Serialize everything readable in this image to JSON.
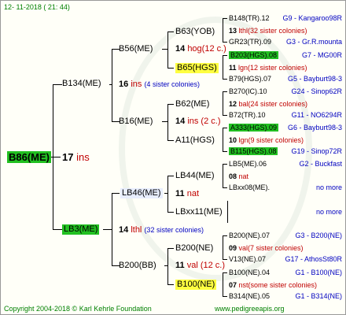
{
  "header": {
    "date": "12- 11-2018 ( 21: 44)"
  },
  "footer": {
    "copyright": "Copyright 2004-2018 © Karl Kehrle Foundation",
    "site": "www.pedigreeapis.org"
  },
  "subject": {
    "name": "B86(ME)",
    "num": "17",
    "tag": "ins"
  },
  "g1": {
    "sire": "B134(ME)",
    "sire_num": "16",
    "sire_tag": "ins",
    "sire_col": "(4 sister colonies)",
    "dam": "LB3(ME)",
    "dam_num": "14",
    "dam_tag": "lthl",
    "dam_col": "(32 sister colonies)"
  },
  "g2": [
    "B56(ME)",
    "B16(ME)",
    "LB46(ME)",
    "B200(BB)"
  ],
  "g2i": [
    {
      "num": "14",
      "tag": "hog(12 c.)"
    },
    {
      "num": "14",
      "tag": "ins (2 c.)"
    },
    {
      "num": "11",
      "tag": "nat"
    },
    {
      "num": "11",
      "tag": "val (12 c.)"
    }
  ],
  "g3": [
    "B63(YOB)",
    "B65(HGS)",
    "B62(ME)",
    "A11(HGS)",
    "LB44(ME)",
    "LBxx11(ME)",
    "B200(NE)",
    "B100(NE)"
  ],
  "g4": [
    {
      "id": "B148(TR).12",
      "loc": "G9 - Kangaroo98R",
      "hl": ""
    },
    {
      "id": "13 lthl(32 sister colonies)",
      "loc": "",
      "hl": ""
    },
    {
      "id": "GR23(TR).09",
      "loc": "G3 - Gr.R.mounta",
      "hl": ""
    },
    {
      "id": "B203(HGS).08",
      "loc": "G7 - MG00R",
      "hl": "green"
    },
    {
      "id": "11 lgn(12 sister colonies)",
      "loc": "",
      "hl": ""
    },
    {
      "id": "B79(HGS).07",
      "loc": "G5 - Bayburt98-3",
      "hl": ""
    },
    {
      "id": "B270(IC).10",
      "loc": "G24 - Sinop62R",
      "hl": ""
    },
    {
      "id": "12 bal(24 sister colonies)",
      "loc": "",
      "hl": ""
    },
    {
      "id": "B72(TR).10",
      "loc": "G11 - NO6294R",
      "hl": ""
    },
    {
      "id": "A333(HGS).09",
      "loc": "G6 - Bayburt98-3",
      "hl": "green"
    },
    {
      "id": "10 lgn(9 sister colonies)",
      "loc": "",
      "hl": ""
    },
    {
      "id": "B115(HGS).08",
      "loc": "G19 - Sinop72R",
      "hl": "green"
    },
    {
      "id": "LB5(ME).06",
      "loc": "G2 - Buckfast",
      "hl": ""
    },
    {
      "id": "08 nat",
      "loc": "",
      "hl": ""
    },
    {
      "id": "LBxx08(ME).",
      "loc": "no more",
      "hl": ""
    },
    {
      "id": "",
      "loc": "no more",
      "hl": ""
    },
    {
      "id": "B200(NE).07",
      "loc": "G3 - B200(NE)",
      "hl": ""
    },
    {
      "id": "09 val(7 sister colonies)",
      "loc": "",
      "hl": ""
    },
    {
      "id": "V13(NE).07",
      "loc": "G17 - AthosSt80R",
      "hl": ""
    },
    {
      "id": "B100(NE).04",
      "loc": "G1 - B100(NE)",
      "hl": ""
    },
    {
      "id": "07 nst(some sister colonies)",
      "loc": "",
      "hl": ""
    },
    {
      "id": "B314(NE).05",
      "loc": "G1 - B314(NE)",
      "hl": ""
    }
  ]
}
